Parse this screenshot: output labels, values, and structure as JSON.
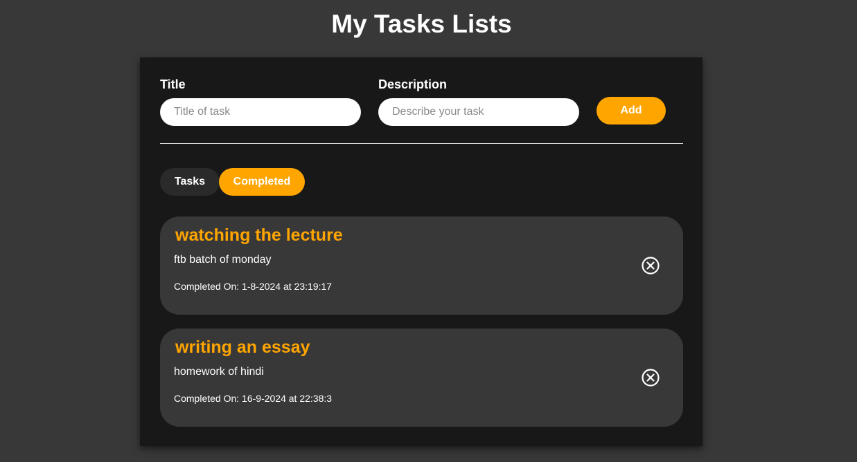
{
  "header": {
    "title": "My Tasks Lists"
  },
  "form": {
    "title_label": "Title",
    "title_placeholder": "Title of task",
    "title_value": "",
    "description_label": "Description",
    "description_placeholder": "Describe your task",
    "description_value": "",
    "add_label": "Add"
  },
  "tabs": {
    "tasks_label": "Tasks",
    "completed_label": "Completed",
    "active": "Completed"
  },
  "tasks": [
    {
      "title": "watching the lecture",
      "description": "ftb batch of monday",
      "completed_on": "Completed On: 1-8-2024 at 23:19:17",
      "icon": "close-circle-icon"
    },
    {
      "title": "writing an essay",
      "description": "homework of hindi",
      "completed_on": "Completed On: 16-9-2024 at 22:38:3",
      "icon": "close-circle-icon"
    }
  ],
  "colors": {
    "background": "#383838",
    "panel": "#181818",
    "card": "#393838",
    "accent": "#ffa500",
    "inactive_tab": "#2a2a2a"
  }
}
